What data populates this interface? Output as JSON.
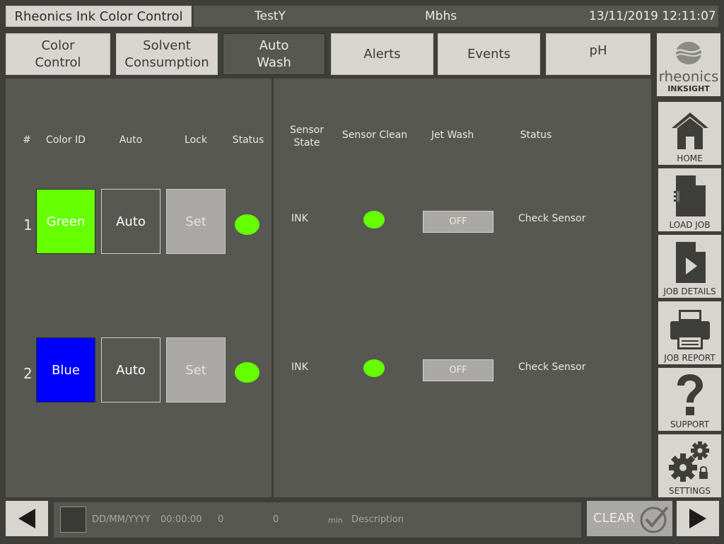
{
  "header": {
    "app_title": "Rheonics Ink Color Control",
    "job_name": "TestY",
    "user": "Mbhs",
    "datetime": "13/11/2019 12:11:07"
  },
  "tabs": [
    {
      "line1": "Color",
      "line2": "Control",
      "active": false
    },
    {
      "line1": "Solvent",
      "line2": "Consumption",
      "active": false
    },
    {
      "line1": "Auto",
      "line2": "Wash",
      "active": true
    },
    {
      "line1": "Alerts",
      "line2": "",
      "active": false
    },
    {
      "line1": "Events",
      "line2": "",
      "active": false
    },
    {
      "line1": "pH",
      "line2": "",
      "active": false
    }
  ],
  "left_headers": {
    "num": "#",
    "color_id": "Color ID",
    "auto": "Auto",
    "lock": "Lock",
    "status": "Status"
  },
  "right_headers": {
    "sensor_state_1": "Sensor",
    "sensor_state_2": "State",
    "sensor_clean": "Sensor Clean",
    "jet_wash": "Jet Wash",
    "status": "Status"
  },
  "rows": [
    {
      "num": "1",
      "color_id": "Green",
      "color": "#66ff00",
      "auto": "Auto",
      "lock": "Set",
      "sensor_state": "INK",
      "jet_wash": "OFF",
      "status": "Check Sensor"
    },
    {
      "num": "2",
      "color_id": "Blue",
      "color": "#0000ff",
      "auto": "Auto",
      "lock": "Set",
      "sensor_state": "INK",
      "jet_wash": "OFF",
      "status": "Check Sensor"
    }
  ],
  "status_led_color": "#66ff00",
  "logo": {
    "brand": "rheonics",
    "product": "INKSIGHT"
  },
  "sidebar": [
    {
      "label": "HOME",
      "icon": "home-icon"
    },
    {
      "label": "LOAD JOB",
      "icon": "document-icon"
    },
    {
      "label": "JOB DETAILS",
      "icon": "play-document-icon"
    },
    {
      "label": "JOB REPORT",
      "icon": "printer-icon"
    },
    {
      "label": "SUPPORT",
      "icon": "question-icon"
    },
    {
      "label": "SETTINGS",
      "icon": "gears-lock-icon"
    }
  ],
  "event_bar": {
    "date": "DD/MM/YYYY",
    "time": "00:00:00",
    "value1": "0",
    "value2": "0",
    "unit": "min",
    "description": "Description"
  },
  "clear_label": "CLEAR"
}
